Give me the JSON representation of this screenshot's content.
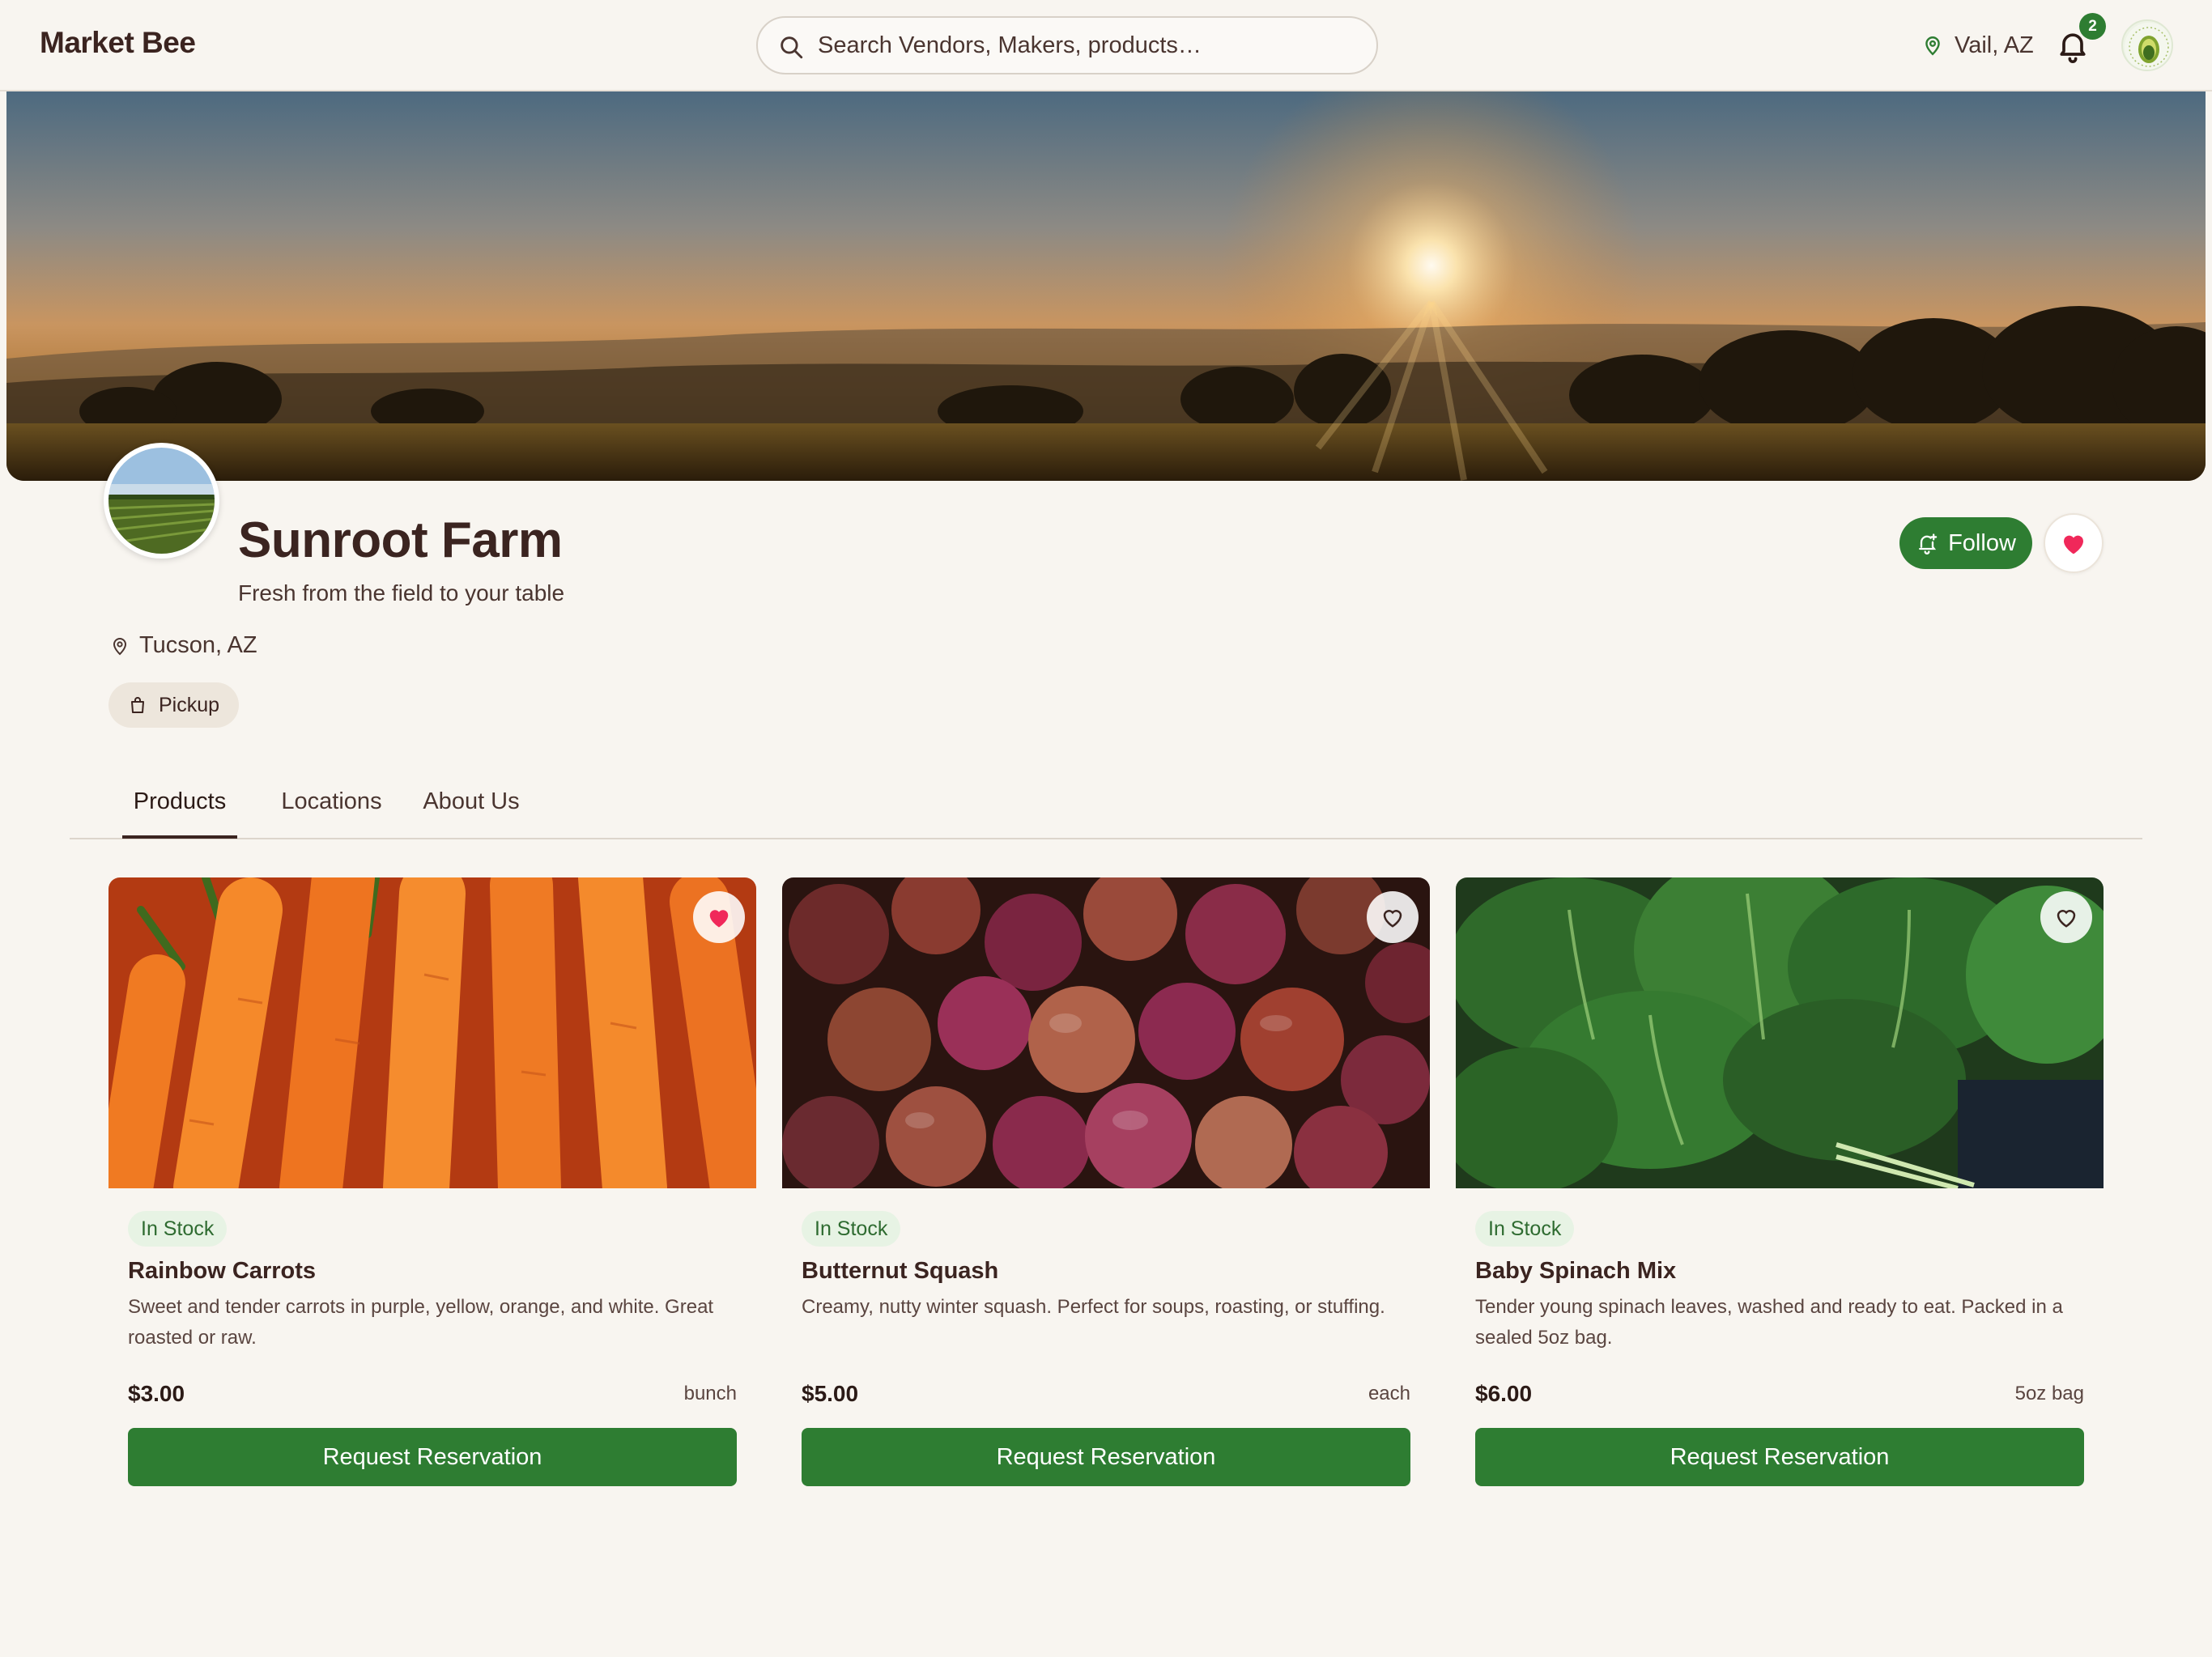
{
  "header": {
    "brand": "Market Bee",
    "search_placeholder": "Search Vendors, Makers, products…",
    "location": "Vail, AZ",
    "notification_count": "2"
  },
  "farm": {
    "name": "Sunroot Farm",
    "tagline": "Fresh from the field to your table",
    "location": "Tucson, AZ",
    "pickup_label": "Pickup",
    "follow_label": "Follow"
  },
  "tabs": [
    {
      "label": "Products",
      "active": true
    },
    {
      "label": "Locations",
      "active": false
    },
    {
      "label": "About Us",
      "active": false
    }
  ],
  "products": [
    {
      "stock": "In Stock",
      "name": "Rainbow Carrots",
      "description": "Sweet and tender carrots in purple, yellow, orange, and white. Great roasted or raw.",
      "price": "$3.00",
      "unit": "bunch",
      "button": "Request Reservation",
      "favorited": true
    },
    {
      "stock": "In Stock",
      "name": "Butternut Squash",
      "description": "Creamy, nutty winter squash. Perfect for soups, roasting, or stuffing.",
      "price": "$5.00",
      "unit": "each",
      "button": "Request Reservation",
      "favorited": false
    },
    {
      "stock": "In Stock",
      "name": "Baby Spinach Mix",
      "description": "Tender young spinach leaves, washed and ready to eat. Packed in a sealed 5oz bag.",
      "price": "$6.00",
      "unit": "5oz bag",
      "button": "Request Reservation",
      "favorited": false
    }
  ],
  "colors": {
    "background": "#f8f5f0",
    "primary_green": "#2e7d32",
    "text_brown": "#3b2420",
    "heart_red": "#f0285a"
  },
  "icons": {
    "search": "search-icon",
    "location": "map-pin-icon",
    "notifications": "bell-icon",
    "follow": "bell-plus-icon",
    "favorite": "heart-icon",
    "pickup": "shopping-bag-icon"
  }
}
